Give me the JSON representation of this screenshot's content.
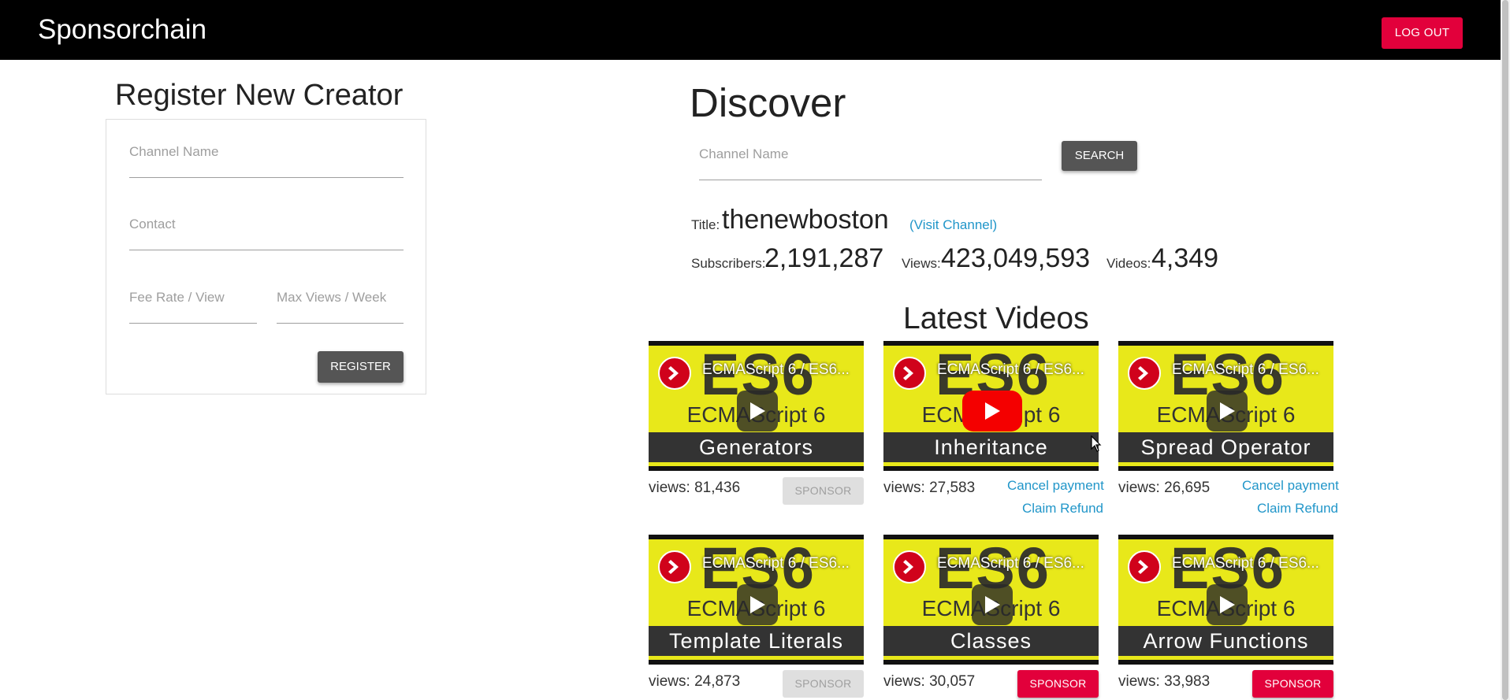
{
  "nav": {
    "brand": "Sponsorchain",
    "logout_label": "LOG OUT"
  },
  "register": {
    "title": "Register New Creator",
    "channel_placeholder": "Channel Name",
    "contact_placeholder": "Contact",
    "fee_placeholder": "Fee Rate / View",
    "max_views_placeholder": "Max Views / Week",
    "register_label": "REGISTER"
  },
  "discover": {
    "title": "Discover",
    "search_placeholder": "Channel Name",
    "search_label": "SEARCH",
    "title_label": "Title:",
    "channel_title": "thenewboston",
    "visit_link": "(Visit Channel)",
    "subscribers_label": "Subscribers:",
    "subscribers": "2,191,287",
    "views_label": "Views:",
    "views": "423,049,593",
    "videos_label": "Videos:",
    "videos": "4,349"
  },
  "latest_title": "Latest Videos",
  "videos": [
    {
      "yt_title": "ECMAScript 6 / ES6...",
      "topic": "Generators",
      "views": "views: 81,436",
      "sponsor_label": "SPONSOR"
    },
    {
      "yt_title": "ECMAScript 6 / ES6...",
      "topic": "Inheritance",
      "views": "views: 27,583",
      "cancel_label": "Cancel payment",
      "refund_label": "Claim Refund"
    },
    {
      "yt_title": "ECMAScript 6 / ES6...",
      "topic": "Spread Operator",
      "views": "views: 26,695",
      "cancel_label": "Cancel payment",
      "refund_label": "Claim Refund"
    },
    {
      "yt_title": "ECMAScript 6 / ES6...",
      "topic": "Template Literals",
      "views": "views: 24,873",
      "sponsor_label": "SPONSOR"
    },
    {
      "yt_title": "ECMAScript 6 / ES6...",
      "topic": "Classes",
      "views": "views: 30,057",
      "sponsor_label": "SPONSOR"
    },
    {
      "yt_title": "ECMAScript 6 / ES6...",
      "topic": "Arrow Functions",
      "views": "views: 33,983",
      "sponsor_label": "SPONSOR"
    }
  ],
  "thumb_text": {
    "big": "ES6",
    "sub": "ECMAScript 6"
  },
  "colors": {
    "accent": "#e2003b",
    "link": "#2196c9",
    "nav_bg": "#000000",
    "thumb_yellow": "#e8e81a"
  }
}
